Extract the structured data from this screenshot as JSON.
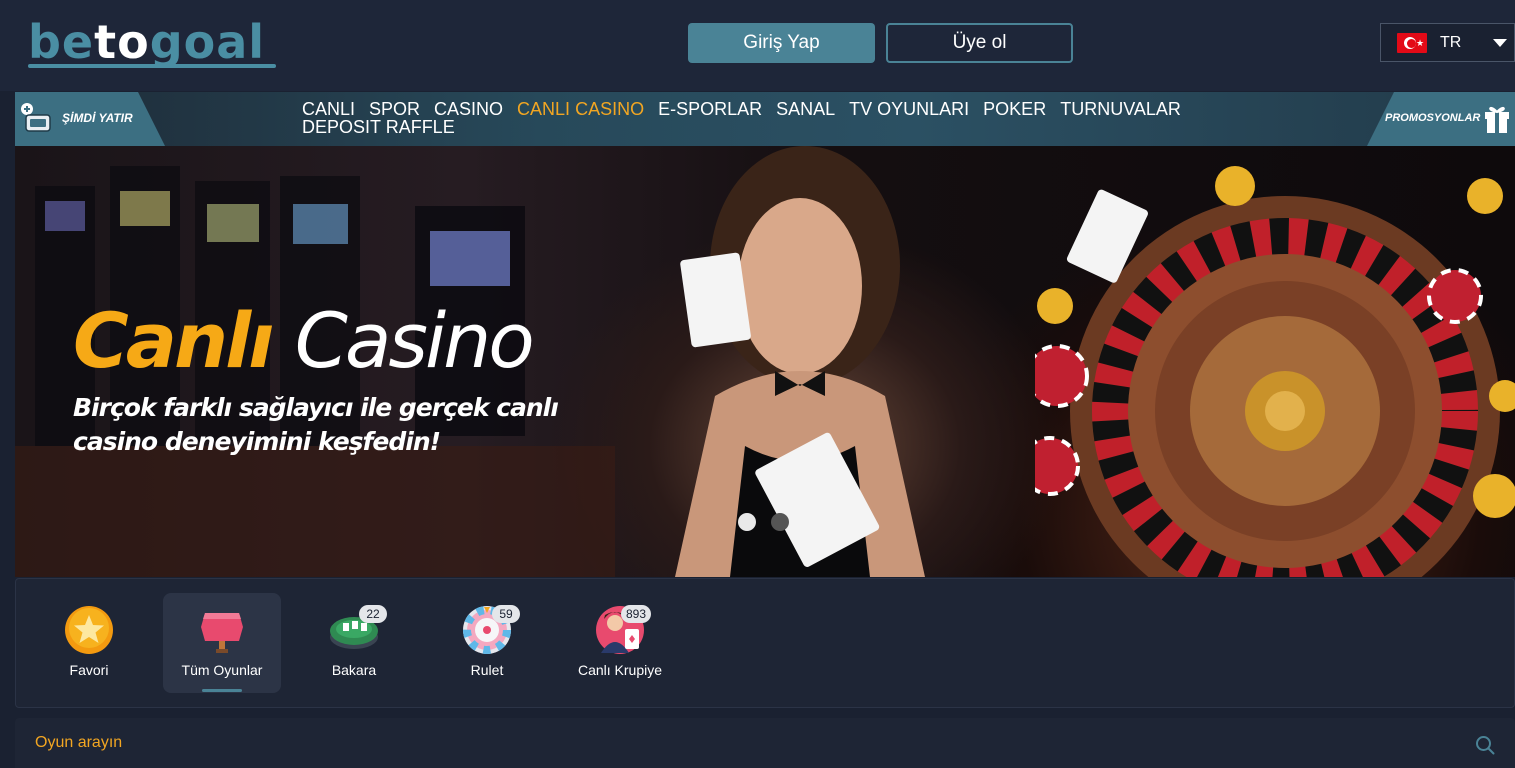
{
  "header": {
    "logo": {
      "left": "be",
      "mid": "to",
      "right": "goal"
    },
    "login_label": "Giriş Yap",
    "register_label": "Üye ol",
    "language": {
      "code": "TR",
      "flag_icon": "turkey-flag-icon"
    }
  },
  "nav": {
    "deposit_label": "ŞİMDİ YATIR",
    "items": [
      {
        "label": "CANLI",
        "active": false
      },
      {
        "label": "SPOR",
        "active": false
      },
      {
        "label": "CASINO",
        "active": false
      },
      {
        "label": "CANLI CASINO",
        "active": true
      },
      {
        "label": "E-SPORLAR",
        "active": false
      },
      {
        "label": "SANAL",
        "active": false
      },
      {
        "label": "TV OYUNLARI",
        "active": false
      },
      {
        "label": "POKER",
        "active": false
      },
      {
        "label": "TURNUVALAR",
        "active": false
      },
      {
        "label": "DEPOSIT RAFFLE",
        "active": false
      }
    ],
    "promo_label": "PROMOSYONLAR",
    "active_color": "#f2a622"
  },
  "hero": {
    "title_word1": "Canlı",
    "title_word2": "Casino",
    "subtitle": "Birçok farklı sağlayıcı ile gerçek canlı casino deneyimini keşfedin!",
    "slides_total": 2,
    "active_slide": 1
  },
  "categories": [
    {
      "label": "Favori",
      "icon": "star-icon",
      "count": null,
      "active": false
    },
    {
      "label": "Tüm Oyunlar",
      "icon": "all-games-icon",
      "count": null,
      "active": true
    },
    {
      "label": "Bakara",
      "icon": "baccarat-table-icon",
      "count": "22",
      "active": false
    },
    {
      "label": "Rulet",
      "icon": "roulette-wheel-icon",
      "count": "59",
      "active": false
    },
    {
      "label": "Canlı Krupiye",
      "icon": "live-dealer-icon",
      "count": "893",
      "active": false
    }
  ],
  "search": {
    "placeholder": "Oyun arayın",
    "icon": "search-icon"
  },
  "colors": {
    "accent": "#4a8396",
    "brand_orange": "#f2a622",
    "background": "#1a2131"
  }
}
